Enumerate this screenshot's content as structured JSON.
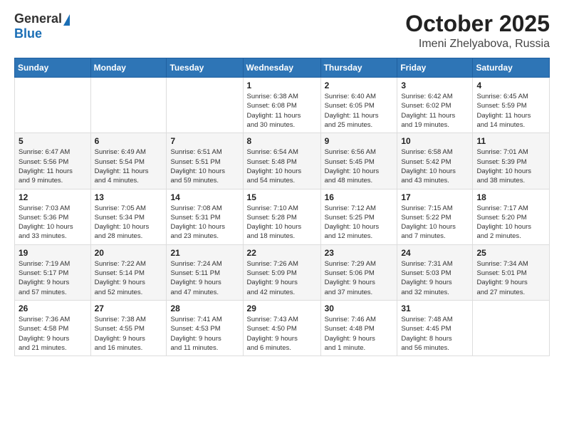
{
  "logo": {
    "general": "General",
    "blue": "Blue"
  },
  "title": "October 2025",
  "subtitle": "Imeni Zhelyabova, Russia",
  "header_days": [
    "Sunday",
    "Monday",
    "Tuesday",
    "Wednesday",
    "Thursday",
    "Friday",
    "Saturday"
  ],
  "weeks": [
    [
      {
        "day": "",
        "info": ""
      },
      {
        "day": "",
        "info": ""
      },
      {
        "day": "",
        "info": ""
      },
      {
        "day": "1",
        "info": "Sunrise: 6:38 AM\nSunset: 6:08 PM\nDaylight: 11 hours\nand 30 minutes."
      },
      {
        "day": "2",
        "info": "Sunrise: 6:40 AM\nSunset: 6:05 PM\nDaylight: 11 hours\nand 25 minutes."
      },
      {
        "day": "3",
        "info": "Sunrise: 6:42 AM\nSunset: 6:02 PM\nDaylight: 11 hours\nand 19 minutes."
      },
      {
        "day": "4",
        "info": "Sunrise: 6:45 AM\nSunset: 5:59 PM\nDaylight: 11 hours\nand 14 minutes."
      }
    ],
    [
      {
        "day": "5",
        "info": "Sunrise: 6:47 AM\nSunset: 5:56 PM\nDaylight: 11 hours\nand 9 minutes."
      },
      {
        "day": "6",
        "info": "Sunrise: 6:49 AM\nSunset: 5:54 PM\nDaylight: 11 hours\nand 4 minutes."
      },
      {
        "day": "7",
        "info": "Sunrise: 6:51 AM\nSunset: 5:51 PM\nDaylight: 10 hours\nand 59 minutes."
      },
      {
        "day": "8",
        "info": "Sunrise: 6:54 AM\nSunset: 5:48 PM\nDaylight: 10 hours\nand 54 minutes."
      },
      {
        "day": "9",
        "info": "Sunrise: 6:56 AM\nSunset: 5:45 PM\nDaylight: 10 hours\nand 48 minutes."
      },
      {
        "day": "10",
        "info": "Sunrise: 6:58 AM\nSunset: 5:42 PM\nDaylight: 10 hours\nand 43 minutes."
      },
      {
        "day": "11",
        "info": "Sunrise: 7:01 AM\nSunset: 5:39 PM\nDaylight: 10 hours\nand 38 minutes."
      }
    ],
    [
      {
        "day": "12",
        "info": "Sunrise: 7:03 AM\nSunset: 5:36 PM\nDaylight: 10 hours\nand 33 minutes."
      },
      {
        "day": "13",
        "info": "Sunrise: 7:05 AM\nSunset: 5:34 PM\nDaylight: 10 hours\nand 28 minutes."
      },
      {
        "day": "14",
        "info": "Sunrise: 7:08 AM\nSunset: 5:31 PM\nDaylight: 10 hours\nand 23 minutes."
      },
      {
        "day": "15",
        "info": "Sunrise: 7:10 AM\nSunset: 5:28 PM\nDaylight: 10 hours\nand 18 minutes."
      },
      {
        "day": "16",
        "info": "Sunrise: 7:12 AM\nSunset: 5:25 PM\nDaylight: 10 hours\nand 12 minutes."
      },
      {
        "day": "17",
        "info": "Sunrise: 7:15 AM\nSunset: 5:22 PM\nDaylight: 10 hours\nand 7 minutes."
      },
      {
        "day": "18",
        "info": "Sunrise: 7:17 AM\nSunset: 5:20 PM\nDaylight: 10 hours\nand 2 minutes."
      }
    ],
    [
      {
        "day": "19",
        "info": "Sunrise: 7:19 AM\nSunset: 5:17 PM\nDaylight: 9 hours\nand 57 minutes."
      },
      {
        "day": "20",
        "info": "Sunrise: 7:22 AM\nSunset: 5:14 PM\nDaylight: 9 hours\nand 52 minutes."
      },
      {
        "day": "21",
        "info": "Sunrise: 7:24 AM\nSunset: 5:11 PM\nDaylight: 9 hours\nand 47 minutes."
      },
      {
        "day": "22",
        "info": "Sunrise: 7:26 AM\nSunset: 5:09 PM\nDaylight: 9 hours\nand 42 minutes."
      },
      {
        "day": "23",
        "info": "Sunrise: 7:29 AM\nSunset: 5:06 PM\nDaylight: 9 hours\nand 37 minutes."
      },
      {
        "day": "24",
        "info": "Sunrise: 7:31 AM\nSunset: 5:03 PM\nDaylight: 9 hours\nand 32 minutes."
      },
      {
        "day": "25",
        "info": "Sunrise: 7:34 AM\nSunset: 5:01 PM\nDaylight: 9 hours\nand 27 minutes."
      }
    ],
    [
      {
        "day": "26",
        "info": "Sunrise: 7:36 AM\nSunset: 4:58 PM\nDaylight: 9 hours\nand 21 minutes."
      },
      {
        "day": "27",
        "info": "Sunrise: 7:38 AM\nSunset: 4:55 PM\nDaylight: 9 hours\nand 16 minutes."
      },
      {
        "day": "28",
        "info": "Sunrise: 7:41 AM\nSunset: 4:53 PM\nDaylight: 9 hours\nand 11 minutes."
      },
      {
        "day": "29",
        "info": "Sunrise: 7:43 AM\nSunset: 4:50 PM\nDaylight: 9 hours\nand 6 minutes."
      },
      {
        "day": "30",
        "info": "Sunrise: 7:46 AM\nSunset: 4:48 PM\nDaylight: 9 hours\nand 1 minute."
      },
      {
        "day": "31",
        "info": "Sunrise: 7:48 AM\nSunset: 4:45 PM\nDaylight: 8 hours\nand 56 minutes."
      },
      {
        "day": "",
        "info": ""
      }
    ]
  ]
}
